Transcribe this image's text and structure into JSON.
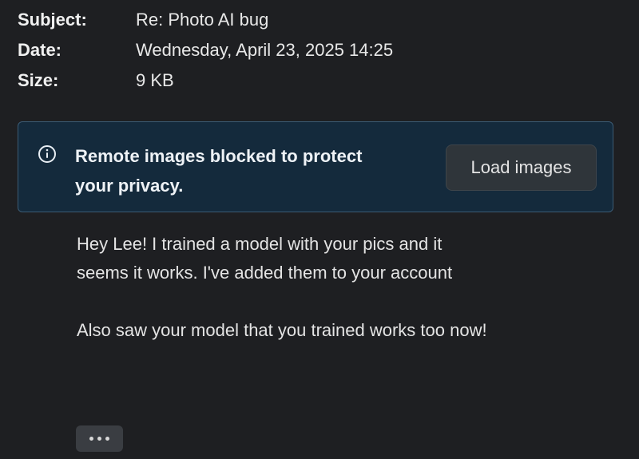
{
  "header": {
    "rows": [
      {
        "label": "Subject:",
        "value": "Re: Photo AI bug"
      },
      {
        "label": "Date:",
        "value": "Wednesday, April 23, 2025 14:25"
      },
      {
        "label": "Size:",
        "value": "9 KB"
      }
    ]
  },
  "banner": {
    "icon": "info-icon",
    "message_line1": "Remote images blocked to protect",
    "message_line2": "your privacy.",
    "button_label": "Load images",
    "accent_color": "#142a3c"
  },
  "message": {
    "para1_line1": "Hey Lee! I trained a model with your pics and it",
    "para1_line2": "seems it works. I've added them to your account",
    "para2": "Also saw your model that you trained works too now!"
  },
  "more_button": {
    "icon": "ellipsis-icon"
  }
}
